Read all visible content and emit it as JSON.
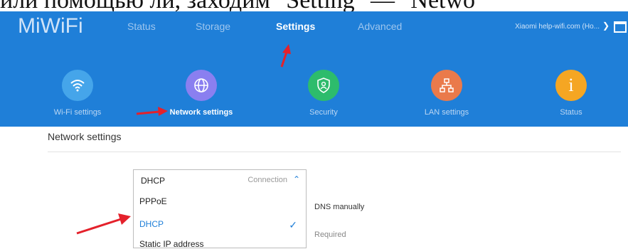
{
  "page_text": "или помощью ли, заходим \"Setting\" — \"Netwo",
  "header": {
    "logo": "MiWiFi",
    "nav": [
      "Status",
      "Storage",
      "Settings",
      "Advanced"
    ],
    "account": "Xiaomi help-wifi.com (Ho...",
    "active_tab": "Settings"
  },
  "tiles": [
    {
      "label": "Wi-Fi settings",
      "color": "#45a5ea",
      "icon": "wifi-icon"
    },
    {
      "label": "Network settings",
      "color": "#8a7ff0",
      "icon": "globe-icon"
    },
    {
      "label": "Security",
      "color": "#2dbc6c",
      "icon": "shield-icon"
    },
    {
      "label": "LAN settings",
      "color": "#ea7a4b",
      "icon": "network-icon"
    },
    {
      "label": "Status",
      "color": "#f5a623",
      "icon": "info-icon"
    }
  ],
  "main": {
    "title": "Network settings",
    "select_value": "DHCP",
    "select_hint": "Connection",
    "options": [
      "PPPoE",
      "DHCP",
      "Static IP address"
    ],
    "selected_option": "DHCP",
    "partial_dns": "DNS manually",
    "partial_required": "Required"
  },
  "colors": {
    "header": "#1f7fd8",
    "accent": "#1f7fd8",
    "arrow": "#e4212b"
  }
}
